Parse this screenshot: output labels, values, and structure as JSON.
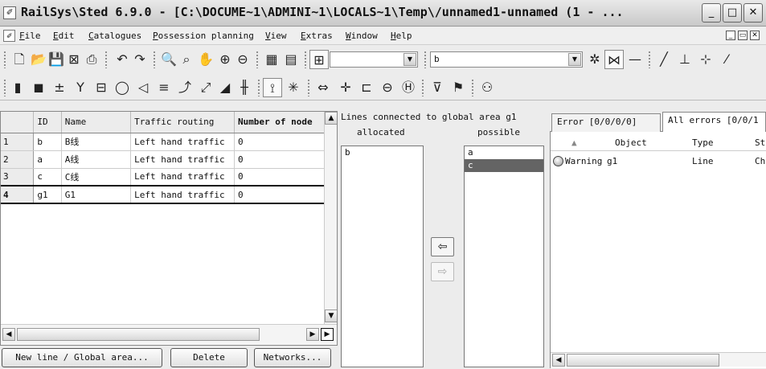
{
  "window": {
    "title": "RailSys\\Sted 6.9.0 - [C:\\DOCUME~1\\ADMINI~1\\LOCALS~1\\Temp\\/unnamed1-unnamed (1 - ...",
    "minimize": "_",
    "maximize": "□",
    "close": "✕"
  },
  "menu": {
    "items": [
      "File",
      "Edit",
      "Catalogues",
      "Possession planning",
      "View",
      "Extras",
      "Window",
      "Help"
    ],
    "mdi_buttons": [
      "_",
      "▭",
      "✕"
    ]
  },
  "toolbar1": {
    "icons": [
      "new-icon",
      "open-icon",
      "save-icon",
      "close-doc-icon",
      "print-icon",
      "undo-icon",
      "redo-icon",
      "zoom-icon",
      "zoom-area-icon",
      "pan-icon",
      "zoom-in-icon",
      "zoom-out-icon",
      "grid-view-icon",
      "panel-view-icon",
      "binoculars-icon"
    ],
    "combo1_value": "",
    "combo2_value": "b",
    "combo3_value": ""
  },
  "table": {
    "columns": [
      "ID",
      "Name",
      "Traffic routing",
      "Number of node"
    ],
    "rows": [
      {
        "num": "1",
        "id": "b",
        "name": "B线",
        "routing": "Left hand traffic",
        "nodes": "0"
      },
      {
        "num": "2",
        "id": "a",
        "name": "A线",
        "routing": "Left hand traffic",
        "nodes": "0"
      },
      {
        "num": "3",
        "id": "c",
        "name": "C线",
        "routing": "Left hand traffic",
        "nodes": "0"
      },
      {
        "num": "4",
        "id": "g1",
        "name": "G1",
        "routing": "Left hand traffic",
        "nodes": "0"
      }
    ]
  },
  "buttons": {
    "new": "New line / Global area...",
    "delete": "Delete",
    "networks": "Networks..."
  },
  "lines_panel": {
    "title": "Lines connected to global area g1",
    "allocated_label": "allocated",
    "possible_label": "possible",
    "allocated": [
      "b"
    ],
    "possible": [
      "a",
      "c"
    ],
    "selected_possible": "c",
    "move_left": "⇦",
    "move_right": "⇨"
  },
  "errors_panel": {
    "tabs": [
      "Error [0/0/0/0]",
      "All errors [0/0/1"
    ],
    "columns": [
      "Object",
      "Type",
      "St"
    ],
    "sort_indicator": "▲",
    "rows": [
      {
        "severity": "Warning",
        "object": "g1",
        "type": "Line",
        "status": "Ch"
      }
    ]
  }
}
